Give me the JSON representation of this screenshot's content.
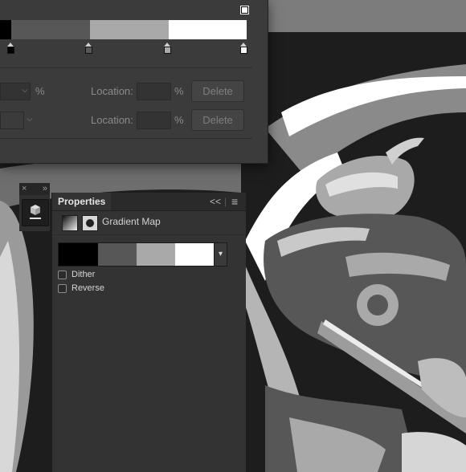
{
  "colors": {
    "stop_black": "#000000",
    "stop_dark": "#575757",
    "stop_light": "#a9a9a9",
    "stop_white": "#ffffff",
    "panel_bg": "#333333",
    "editor_bg": "#3b3b3b"
  },
  "gradient_editor": {
    "stops": [
      "#000000",
      "#575757",
      "#a9a9a9",
      "#ffffff"
    ],
    "opacity_row": {
      "percent_unit": "%",
      "location_label": "Location:",
      "location_unit": "%",
      "delete_label": "Delete"
    },
    "color_row": {
      "location_label": "Location:",
      "location_unit": "%",
      "delete_label": "Delete"
    }
  },
  "tool_strip": {
    "close_glyph": "×",
    "expand_glyph": "»",
    "icon": "3d-cube-icon"
  },
  "properties": {
    "tab_label": "Properties",
    "collapse_glyph": "<<",
    "menu_glyph": "≡",
    "adjustment_title": "Gradient Map",
    "gradient_stops": [
      "#000000",
      "#575757",
      "#a9a9a9",
      "#ffffff"
    ],
    "dither_label": "Dither",
    "dither_checked": false,
    "reverse_label": "Reverse",
    "reverse_checked": false
  }
}
